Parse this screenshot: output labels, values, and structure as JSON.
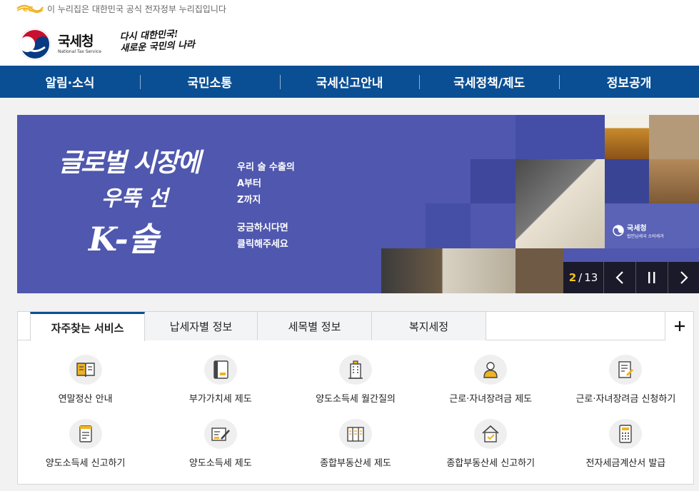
{
  "gov_notice": {
    "text": "이 누리집은 대한민국 공식 전자정부 누리집입니다",
    "badge_icon": "eg-emblem-icon"
  },
  "header": {
    "logo_ko": "국세청",
    "logo_en": "National Tax Service",
    "slogan_line1": "다시 대한민국!",
    "slogan_line2": "새로운 국민의 나라"
  },
  "nav": {
    "items": [
      "알림·소식",
      "국민소통",
      "국세신고안내",
      "국세정책/제도",
      "정보공개"
    ]
  },
  "banner": {
    "calligraphy_l1": "글로벌 시장에",
    "calligraphy_l2": "우뚝 선",
    "calligraphy_l3": "K-술",
    "copy": [
      "우리 술 수출의",
      "A부터",
      "Z까지",
      "궁금하시다면",
      "클릭해주세요"
    ],
    "badge_title": "국세청",
    "badge_sub": "법인납세국 소비세과",
    "counter_current": "2",
    "counter_sep": "/",
    "counter_total": "13",
    "colors": {
      "background": "#4f57ae",
      "accent": "#f5c518"
    }
  },
  "service": {
    "tabs": [
      "자주찾는 서비스",
      "납세자별 정보",
      "세목별 정보",
      "복지세정"
    ],
    "active_tab": "자주찾는 서비스",
    "more_icon": "plus-icon",
    "items": [
      {
        "label": "연말정산 안내",
        "icon": "book-icon"
      },
      {
        "label": "부가가치세 제도",
        "icon": "binder-icon"
      },
      {
        "label": "양도소득세 월간질의",
        "icon": "building-icon"
      },
      {
        "label": "근로·자녀장려금 제도",
        "icon": "person-icon"
      },
      {
        "label": "근로·자녀장려금 신청하기",
        "icon": "form-edit-icon"
      },
      {
        "label": "양도소득세 신고하기",
        "icon": "document-icon"
      },
      {
        "label": "양도소득세 제도",
        "icon": "pen-card-icon"
      },
      {
        "label": "종합부동산세 제도",
        "icon": "ledger-icon"
      },
      {
        "label": "종합부동산세 신고하기",
        "icon": "house-check-icon"
      },
      {
        "label": "전자세금계산서 발급",
        "icon": "calculator-icon"
      }
    ]
  },
  "colors": {
    "primary": "#0a4f94",
    "icon_accent": "#f0b323",
    "icon_dark": "#444444"
  }
}
